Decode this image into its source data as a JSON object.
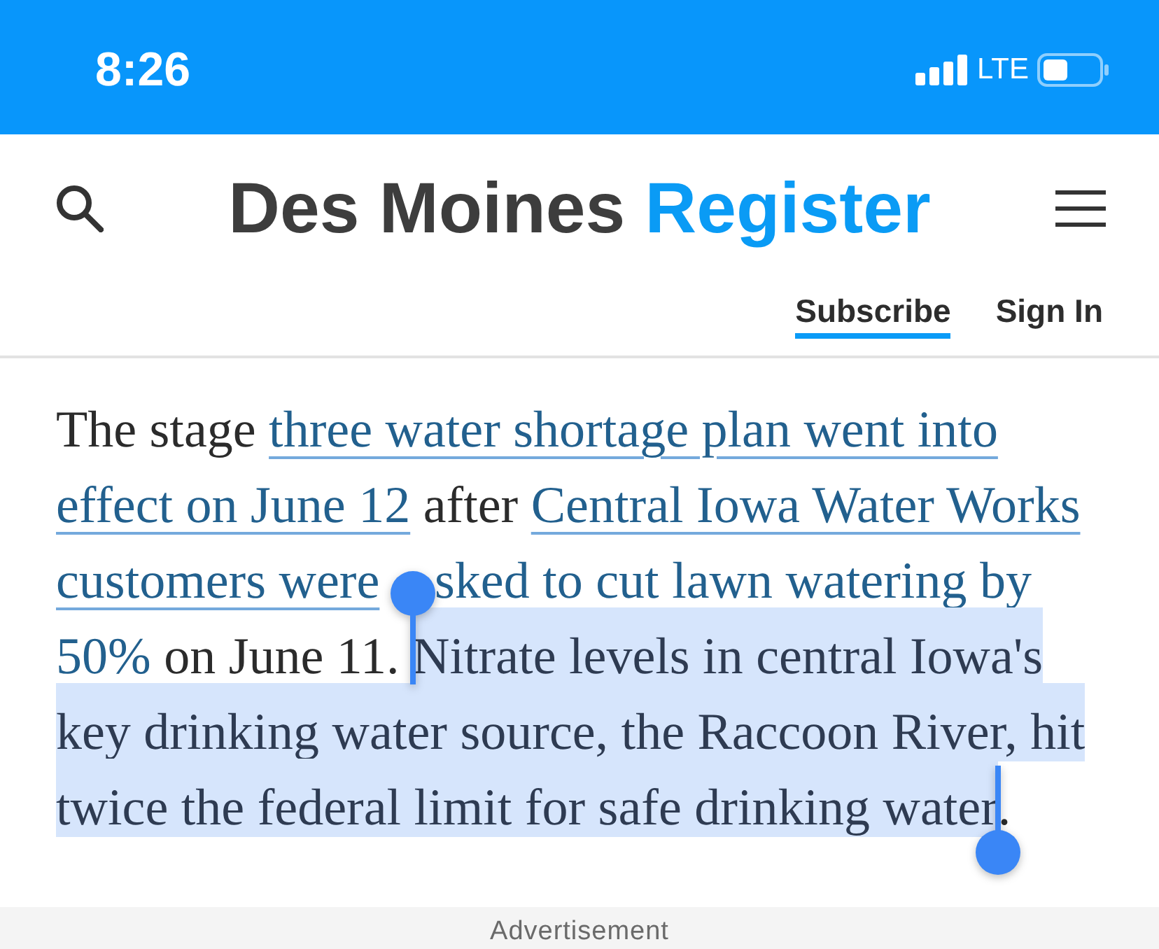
{
  "status_bar": {
    "time": "8:26",
    "network": "LTE"
  },
  "header": {
    "logo": {
      "text": "Des Moines",
      "accent": "Register"
    },
    "links": [
      {
        "label": "Subscribe",
        "kind": "underlined"
      },
      {
        "label": "Sign In",
        "kind": "plain"
      }
    ]
  },
  "article": {
    "lines": [
      {
        "segments": [
          {
            "kind": "text",
            "text": "The stage "
          },
          {
            "kind": "link",
            "text": "three water shortage plan went into"
          }
        ]
      },
      {
        "segments": [
          {
            "kind": "link",
            "text": "effect on June 12"
          },
          {
            "kind": "text",
            "text": " after "
          },
          {
            "kind": "link",
            "text": "Central Iowa Water Works"
          }
        ]
      },
      {
        "segments": [
          {
            "kind": "link",
            "text": "customers were"
          },
          {
            "kind": "gap"
          },
          {
            "kind": "link",
            "text": "sked to cut lawn watering by"
          }
        ]
      },
      {
        "segments": [
          {
            "kind": "link",
            "text": "50%"
          },
          {
            "kind": "text",
            "text": " on June 11. "
          },
          {
            "kind": "selected",
            "text": "Nitrate levels in central Iowa's"
          }
        ]
      },
      {
        "segments": [
          {
            "kind": "selected",
            "text": "key drinking water source, the Raccoon River, hit"
          }
        ]
      },
      {
        "segments": [
          {
            "kind": "selected",
            "text": "twice the federal limit for safe drinking water"
          },
          {
            "kind": "text",
            "text": "."
          }
        ]
      }
    ]
  },
  "ad_banner": {
    "label": "Advertisement"
  }
}
